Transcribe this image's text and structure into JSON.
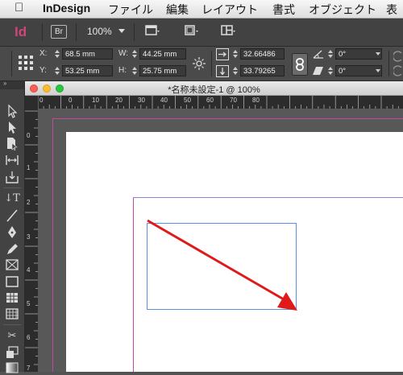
{
  "menubar": {
    "apple_icon": "apple-icon",
    "items": [
      "InDesign",
      "ファイル",
      "編集",
      "レイアウト",
      "書式",
      "オブジェクト",
      "表"
    ]
  },
  "appbar": {
    "logo": "Id",
    "bridge_label": "Br",
    "zoom_value": "100%"
  },
  "control": {
    "x_label": "X:",
    "x_value": "68.5 mm",
    "y_label": "Y:",
    "y_value": "53.25 mm",
    "w_label": "W:",
    "w_value": "44.25 mm",
    "h_label": "H:",
    "h_value": "25.75 mm",
    "scale_x": "32.66486",
    "scale_y": "33.79265",
    "rotate": "0°",
    "shear": "0°"
  },
  "document": {
    "title": "*名称未設定-1 @ 100%",
    "h_ruler_ticks": [
      "0",
      "0",
      "10",
      "20",
      "30",
      "40",
      "50",
      "60",
      "70",
      "80"
    ],
    "v_ruler_ticks": [
      "0",
      "1",
      "2",
      "3",
      "4",
      "5",
      "6",
      "7"
    ]
  },
  "colors": {
    "accent_red": "#e0191b",
    "frame_blue": "#5b8fe3",
    "page_margin": "#c04a9b",
    "logo_pink": "#d2457a"
  }
}
